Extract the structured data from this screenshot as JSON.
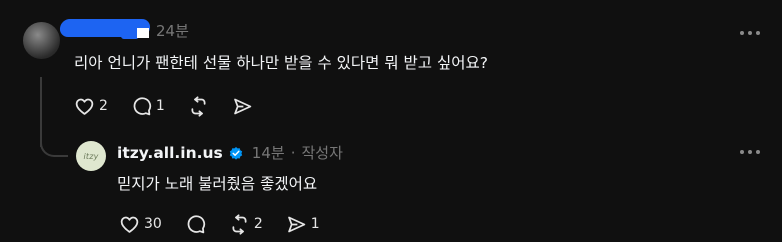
{
  "top_post": {
    "time": "24분",
    "text": "리아 언니가 팬한테 선물 하나만 받을 수 있다면 뭐 받고 싶어요?",
    "likes": "2",
    "replies": "1"
  },
  "reply_post": {
    "username": "itzy.all.in.us",
    "avatar_text": "itzy",
    "time": "14분",
    "separator": "·",
    "author_tag": "작성자",
    "text": "믿지가 노래 불러줬음 좋겠어요",
    "likes": "30",
    "reposts": "2",
    "shares": "1"
  },
  "icons": {
    "like": "heart-icon",
    "reply": "comment-icon",
    "repost": "repost-icon",
    "share": "send-icon",
    "more": "more-dots-icon",
    "verified": "verified-badge-icon"
  },
  "colors": {
    "background": "#101010",
    "text": "#f3f5f7",
    "muted": "#777777",
    "verified": "#0095f6",
    "redaction": "#1d64f2"
  }
}
